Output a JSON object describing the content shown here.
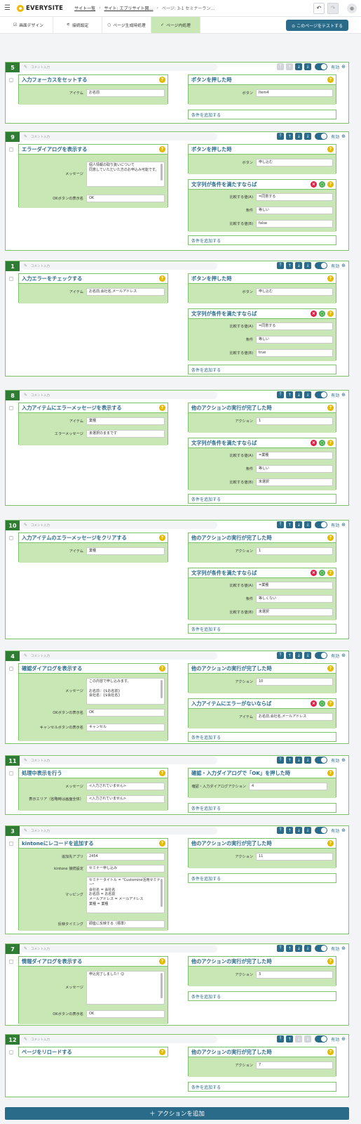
{
  "header": {
    "logo_text": "EVERYSITE",
    "breadcrumbs": [
      "サイト一覧",
      "サイト: エブリサイト図…",
      "ページ: 3-1 セミナーラン…"
    ],
    "undo_icon": "↶",
    "redo_icon": "↷"
  },
  "tabs": [
    {
      "label": "画面デザイン",
      "icon": "☑"
    },
    {
      "label": "接続設定",
      "icon": "⚟"
    },
    {
      "label": "ページ生成時処理",
      "icon": "○"
    },
    {
      "label": "ページ内処理",
      "icon": "✓"
    }
  ],
  "test_button": "⊙ このページをテストする",
  "comment_placeholder": "コメント入力",
  "enabled_label": "有効",
  "add_condition_label": "条件を追加する",
  "add_action_label": "＋ アクションを追加",
  "blocks": [
    {
      "num": "5",
      "action": {
        "title": "入力フォーカスをセットする",
        "fields": [
          {
            "label": "アイテム",
            "value": "お名前"
          }
        ]
      },
      "trigger": {
        "title": "ボタンを押した時",
        "fields": [
          {
            "label": "ボタン",
            "value": "Item4"
          }
        ]
      },
      "conditions": []
    },
    {
      "num": "9",
      "action": {
        "title": "エラーダイアログを表示する",
        "fields": [
          {
            "label": "メッセージ",
            "value": "個人情報の取り扱いについて\n同意していただいた方のお申込み可能です。"
          },
          {
            "label": "OKボタンの表示名",
            "value": "OK"
          }
        ]
      },
      "trigger": {
        "title": "ボタンを押した時",
        "fields": [
          {
            "label": "ボタン",
            "value": "申し込む"
          }
        ]
      },
      "conditions": [
        {
          "title": "文字列が条件を満たすならば",
          "fields": [
            {
              "label": "比較する値(A)",
              "value": "=同意する"
            },
            {
              "label": "条件",
              "value": "等しい"
            },
            {
              "label": "比較する値(B)",
              "value": "false"
            }
          ]
        }
      ]
    },
    {
      "num": "1",
      "action": {
        "title": "入力エラーをチェックする",
        "fields": [
          {
            "label": "アイテム",
            "value": "お名前,会社名,メールアドレス"
          }
        ]
      },
      "trigger": {
        "title": "ボタンを押した時",
        "fields": [
          {
            "label": "ボタン",
            "value": "申し込む"
          }
        ]
      },
      "conditions": [
        {
          "title": "文字列が条件を満たすならば",
          "fields": [
            {
              "label": "比較する値(A)",
              "value": "=同意する"
            },
            {
              "label": "条件",
              "value": "等しい"
            },
            {
              "label": "比較する値(B)",
              "value": "true"
            }
          ]
        }
      ]
    },
    {
      "num": "8",
      "action": {
        "title": "入力アイテムにエラーメッセージを表示する",
        "fields": [
          {
            "label": "アイテム",
            "value": "業種"
          },
          {
            "label": "エラーメッセージ",
            "value": "未選択のままです"
          }
        ]
      },
      "trigger": {
        "title": "他のアクションの実行が完了した時",
        "fields": [
          {
            "label": "アクション",
            "value": "1"
          }
        ]
      },
      "conditions": [
        {
          "title": "文字列が条件を満たすならば",
          "fields": [
            {
              "label": "比較する値(A)",
              "value": "=業種"
            },
            {
              "label": "条件",
              "value": "等しい"
            },
            {
              "label": "比較する値(B)",
              "value": "未選択"
            }
          ]
        }
      ]
    },
    {
      "num": "10",
      "action": {
        "title": "入力アイテムのエラーメッセージをクリアする",
        "fields": [
          {
            "label": "アイテム",
            "value": "業種"
          }
        ]
      },
      "trigger": {
        "title": "他のアクションの実行が完了した時",
        "fields": [
          {
            "label": "アクション",
            "value": "1"
          }
        ]
      },
      "conditions": [
        {
          "title": "文字列が条件を満たすならば",
          "fields": [
            {
              "label": "比較する値(A)",
              "value": "=業種"
            },
            {
              "label": "条件",
              "value": "等しくない"
            },
            {
              "label": "比較する値(B)",
              "value": "未選択"
            }
          ]
        }
      ]
    },
    {
      "num": "4",
      "action": {
        "title": "確認ダイアログを表示する",
        "fields": [
          {
            "label": "メッセージ",
            "value": "この内容で申し込みます。\n\nお名前：{$お名前}\n会社名：{$会社名}"
          },
          {
            "label": "OKボタンの表示名",
            "value": "OK"
          },
          {
            "label": "キャンセルボタンの表示名",
            "value": "キャンセル"
          }
        ]
      },
      "trigger": {
        "title": "他のアクションの実行が完了した時",
        "fields": [
          {
            "label": "アクション",
            "value": "10"
          }
        ]
      },
      "conditions": [
        {
          "title": "入力アイテムにエラーがないならば",
          "fields": [
            {
              "label": "アイテム",
              "value": "お名前,会社名,メールアドレス"
            }
          ]
        }
      ]
    },
    {
      "num": "11",
      "action": {
        "title": "処理中表示を行う",
        "fields": [
          {
            "label": "メッセージ",
            "value": "<入力されていません>"
          },
          {
            "label": "表示エリア（省略時は画面全体）",
            "value": "<入力されていません>"
          }
        ]
      },
      "trigger": {
        "title": "確認・入力ダイアログで「OK」を押した時",
        "fields": [
          {
            "label": "確認・入力ダイアログアクション",
            "value": "4"
          }
        ]
      },
      "conditions": []
    },
    {
      "num": "3",
      "action": {
        "title": "kintoneにレコードを追加する",
        "fields": [
          {
            "label": "追加先アプリ",
            "value": "2454"
          },
          {
            "label": "kintone 接続設定",
            "value": "セミナー申し込み"
          },
          {
            "label": "マッピング",
            "value": "セミナータイトル = \"Customine活用セミナー\"\n会社名 = 会社名\nお名前 = お名前\nメールアドレス = メールアドレス\n業種 = 業種"
          },
          {
            "label": "反映タイミング",
            "value": "即座に反映する（標準）"
          }
        ]
      },
      "trigger": {
        "title": "他のアクションの実行が完了した時",
        "fields": [
          {
            "label": "アクション",
            "value": "11"
          }
        ]
      },
      "conditions": []
    },
    {
      "num": "7",
      "action": {
        "title": "情報ダイアログを表示する",
        "fields": [
          {
            "label": "メッセージ",
            "value": "申込完了しました！☺"
          },
          {
            "label": "OKボタンの表示名",
            "value": "OK"
          }
        ]
      },
      "trigger": {
        "title": "他のアクションの実行が完了した時",
        "fields": [
          {
            "label": "アクション",
            "value": "3"
          }
        ]
      },
      "conditions": []
    },
    {
      "num": "12",
      "action": {
        "title": "ページをリロードする",
        "fields": []
      },
      "trigger": {
        "title": "他のアクションの実行が完了した時",
        "fields": [
          {
            "label": "アクション",
            "value": "7"
          }
        ]
      },
      "conditions": []
    }
  ]
}
